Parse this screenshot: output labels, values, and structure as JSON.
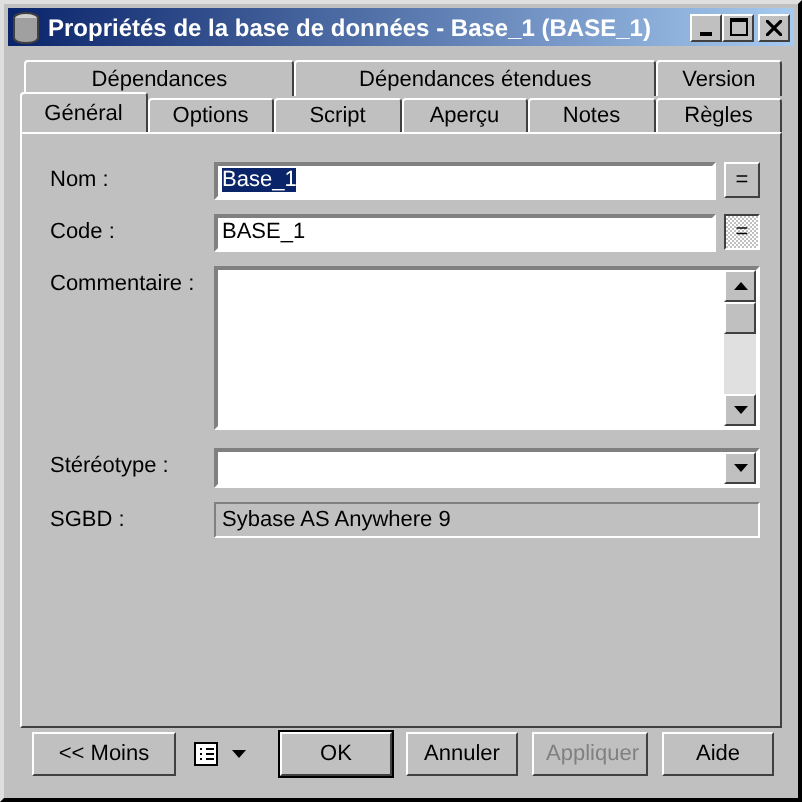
{
  "window": {
    "title": "Propriétés de la base de données - Base_1 (BASE_1)"
  },
  "tab_rows": [
    [
      {
        "label": "Dépendances",
        "selected": false
      },
      {
        "label": "Dépendances étendues",
        "selected": false
      },
      {
        "label": "Version",
        "selected": false
      }
    ],
    [
      {
        "label": "Général",
        "selected": true
      },
      {
        "label": "Options",
        "selected": false
      },
      {
        "label": "Script",
        "selected": false
      },
      {
        "label": "Aperçu",
        "selected": false
      },
      {
        "label": "Notes",
        "selected": false
      },
      {
        "label": "Règles",
        "selected": false
      }
    ]
  ],
  "fields": [
    {
      "kind": "text",
      "label": "Nom :",
      "value": "Base_1",
      "highlighted": true,
      "button": {
        "label": "=",
        "pressed": false
      }
    },
    {
      "kind": "text",
      "label": "Code :",
      "value": "BASE_1",
      "highlighted": false,
      "button": {
        "label": "=",
        "pressed": true
      }
    },
    {
      "kind": "textarea",
      "label": "Commentaire :"
    },
    {
      "kind": "combo",
      "label": "Stéréotype :"
    },
    {
      "kind": "readonly",
      "label": "SGBD :",
      "value": "Sybase AS Anywhere 9"
    }
  ],
  "buttons": [
    {
      "label": "<< Moins",
      "disabled": false,
      "default": false
    },
    {
      "label": "OK",
      "disabled": false,
      "default": true
    },
    {
      "label": "Annuler",
      "disabled": false,
      "default": false
    },
    {
      "label": "Appliquer",
      "disabled": true,
      "default": false
    },
    {
      "label": "Aide",
      "disabled": false,
      "default": false
    }
  ]
}
